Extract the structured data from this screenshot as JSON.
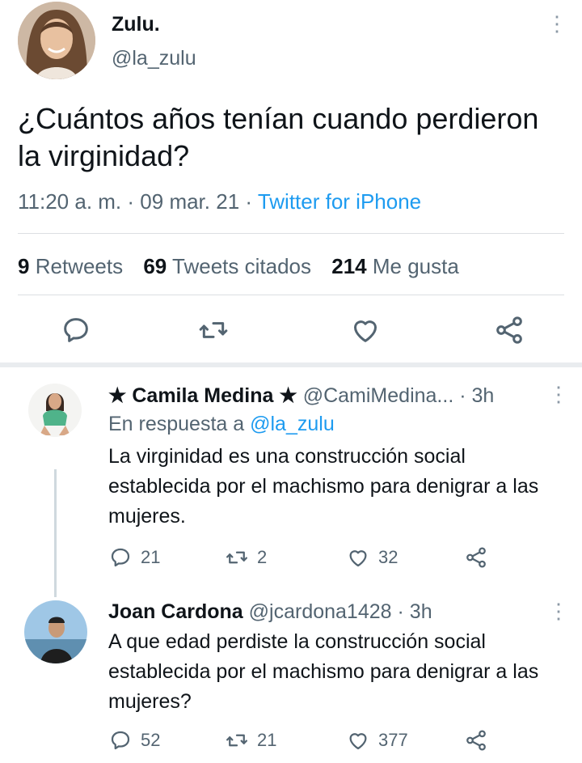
{
  "tweet": {
    "name": "Zulu.",
    "handle": "@la_zulu",
    "text": "¿Cuántos años tenían cuando perdieron la virginidad?",
    "time": "11:20 a. m.",
    "dot1": "·",
    "date": "09 mar. 21",
    "dot2": "·",
    "source": "Twitter for iPhone",
    "stats": {
      "retweets_count": "9",
      "retweets_label": "Retweets",
      "quotes_count": "69",
      "quotes_label": "Tweets citados",
      "likes_count": "214",
      "likes_label": "Me gusta"
    },
    "menu_glyph": "⋮"
  },
  "replies": [
    {
      "name": "★ Camila Medina ★",
      "handle": "@CamiMedina...",
      "dot": "·",
      "time": "3h",
      "reply_to_label": "En respuesta a",
      "reply_to_handle": "@la_zulu",
      "text": "La virginidad es una construcción social establecida por el machismo para denigrar a las mujeres.",
      "replies": "21",
      "retweets": "2",
      "likes": "32",
      "menu_glyph": "⋮"
    },
    {
      "name": "Joan Cardona",
      "handle": "@jcardona1428",
      "dot": "·",
      "time": "3h",
      "text": "A que edad perdiste la construcción social establecida por el machismo para denigrar a las mujeres?",
      "replies": "52",
      "retweets": "21",
      "likes": "377",
      "menu_glyph": "⋮"
    }
  ],
  "icons": [
    "reply-icon",
    "retweet-icon",
    "like-icon",
    "share-icon",
    "more-icon"
  ],
  "colors": {
    "link": "#1d9bf0",
    "muted": "#536471",
    "text": "#0f1419",
    "divider": "#dcdfe2"
  }
}
